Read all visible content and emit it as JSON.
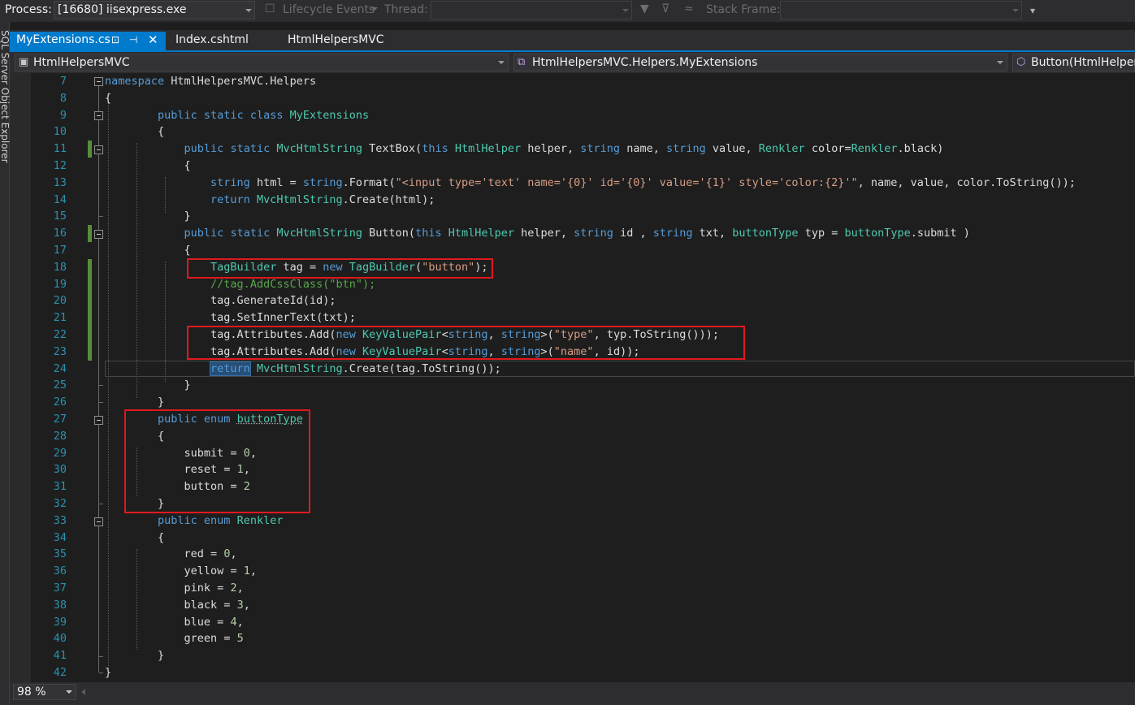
{
  "toolbar": {
    "process_label": "Process:",
    "process_value": "[16680] iisexpress.exe",
    "lifecycle_label": "Lifecycle Events",
    "thread_label": "Thread:",
    "stack_frame_label": "Stack Frame:"
  },
  "side_panel": {
    "label": "SQL Server Object Explorer"
  },
  "tabs": [
    {
      "label": "MyExtensions.cs",
      "active": true
    },
    {
      "label": "Index.cshtml",
      "active": false
    },
    {
      "label": "HtmlHelpersMVC",
      "active": false
    }
  ],
  "navbar": {
    "project": "HtmlHelpersMVC",
    "type": "HtmlHelpersMVC.Helpers.MyExtensions",
    "member": "Button(HtmlHelper"
  },
  "editor": {
    "line_numbers": [
      "7",
      "8",
      "9",
      "10",
      "11",
      "12",
      "13",
      "14",
      "15",
      "16",
      "17",
      "18",
      "19",
      "20",
      "21",
      "22",
      "23",
      "24",
      "25",
      "26",
      "27",
      "28",
      "29",
      "30",
      "31",
      "32",
      "33",
      "34",
      "35",
      "36",
      "37",
      "38",
      "39",
      "40",
      "41",
      "42"
    ],
    "lines": {
      "l7_kw": "namespace",
      "l7_name": " HtmlHelpersMVC.Helpers",
      "brace_open": "{",
      "brace_close": "}",
      "l9_kw": "public static class",
      "l9_type": "MyExtensions",
      "l11_kw1": "public static",
      "l11_type1": "MvcHtmlString",
      "l11_t1": " TextBox(",
      "l11_kw2": "this",
      "l11_type2": "HtmlHelper",
      "l11_t2": " helper, ",
      "l11_kw3": "string",
      "l11_t3": " name, ",
      "l11_kw4": "string",
      "l11_t4": " value, ",
      "l11_type3": "Renkler",
      "l11_t5": " color=",
      "l11_type4": "Renkler",
      "l11_t6": ".black)",
      "l13_kw1": "string",
      "l13_t1": " html = ",
      "l13_kw2": "string",
      "l13_t2": ".Format(",
      "l13_str": "\"<input type='text' name='{0}' id='{0}' value='{1}' style='color:{2}'\"",
      "l13_t3": ", name, value, color.ToString());",
      "l14_kw": "return",
      "l14_type": "MvcHtmlString",
      "l14_t": ".Create(html);",
      "l16_kw1": "public static",
      "l16_type1": "MvcHtmlString",
      "l16_t1": " Button(",
      "l16_kw2": "this",
      "l16_type2": "HtmlHelper",
      "l16_t2": " helper, ",
      "l16_kw3": "string",
      "l16_t3": " id , ",
      "l16_kw4": "string",
      "l16_t4": " txt, ",
      "l16_type3": "buttonType",
      "l16_t5": " typ = ",
      "l16_type4": "buttonType",
      "l16_t6": ".submit )",
      "l18_type1": "TagBuilder",
      "l18_t1": " tag = ",
      "l18_kw": "new",
      "l18_type2": "TagBuilder",
      "l18_t2": "(",
      "l18_str": "\"button\"",
      "l18_t3": ");",
      "l19_comment": "//tag.AddCssClass(\"btn\");",
      "l20": "tag.GenerateId(id);",
      "l21": "tag.SetInnerText(txt);",
      "l22_t1": "tag.Attributes.Add(",
      "l22_kw": "new",
      "l22_type": "KeyValuePair",
      "l22_t2": "<",
      "l22_kw2": "string",
      "l22_t3": ", ",
      "l22_kw3": "string",
      "l22_t4": ">(",
      "l22_str": "\"type\"",
      "l22_t5": ", typ.ToString()));",
      "l23_t1": "tag.Attributes.Add(",
      "l23_kw": "new",
      "l23_type": "KeyValuePair",
      "l23_t2": "<",
      "l23_kw2": "string",
      "l23_t3": ", ",
      "l23_kw3": "string",
      "l23_t4": ">(",
      "l23_str": "\"name\"",
      "l23_t5": ", id));",
      "l24_kw": "return",
      "l24_type": "MvcHtmlString",
      "l24_t": ".Create(tag.ToString());",
      "l27_kw": "public enum",
      "l27_type": "buttonType",
      "l29": "submit = ",
      "l29_num": "0",
      "l29_end": ",",
      "l30": "reset = ",
      "l30_num": "1",
      "l30_end": ",",
      "l31": "button = ",
      "l31_num": "2",
      "l33_kw": "public enum",
      "l33_type": "Renkler",
      "l35": "red = ",
      "l35_num": "0",
      "l36": "yellow = ",
      "l36_num": "1",
      "l37": "pink = ",
      "l37_num": "2",
      "l38": "black = ",
      "l38_num": "3",
      "l39": "blue = ",
      "l39_num": "4",
      "l40": "green = ",
      "l40_num": "5",
      "comma": ","
    }
  },
  "status": {
    "zoom": "98 %"
  },
  "colors": {
    "accent": "#007acc",
    "keyword": "#569cd6",
    "type": "#4ec9b0",
    "string": "#d69d85",
    "comment": "#57a64a",
    "line_number": "#2b91af",
    "annotation_box": "#e0191e"
  },
  "icons": {
    "process_dropdown": "chevron-down-icon",
    "filter": "filter-icon",
    "tab_pin": "pin-icon",
    "tab_close": "close-icon",
    "project": "csharp-project-icon",
    "class": "class-icon",
    "method": "method-icon"
  }
}
